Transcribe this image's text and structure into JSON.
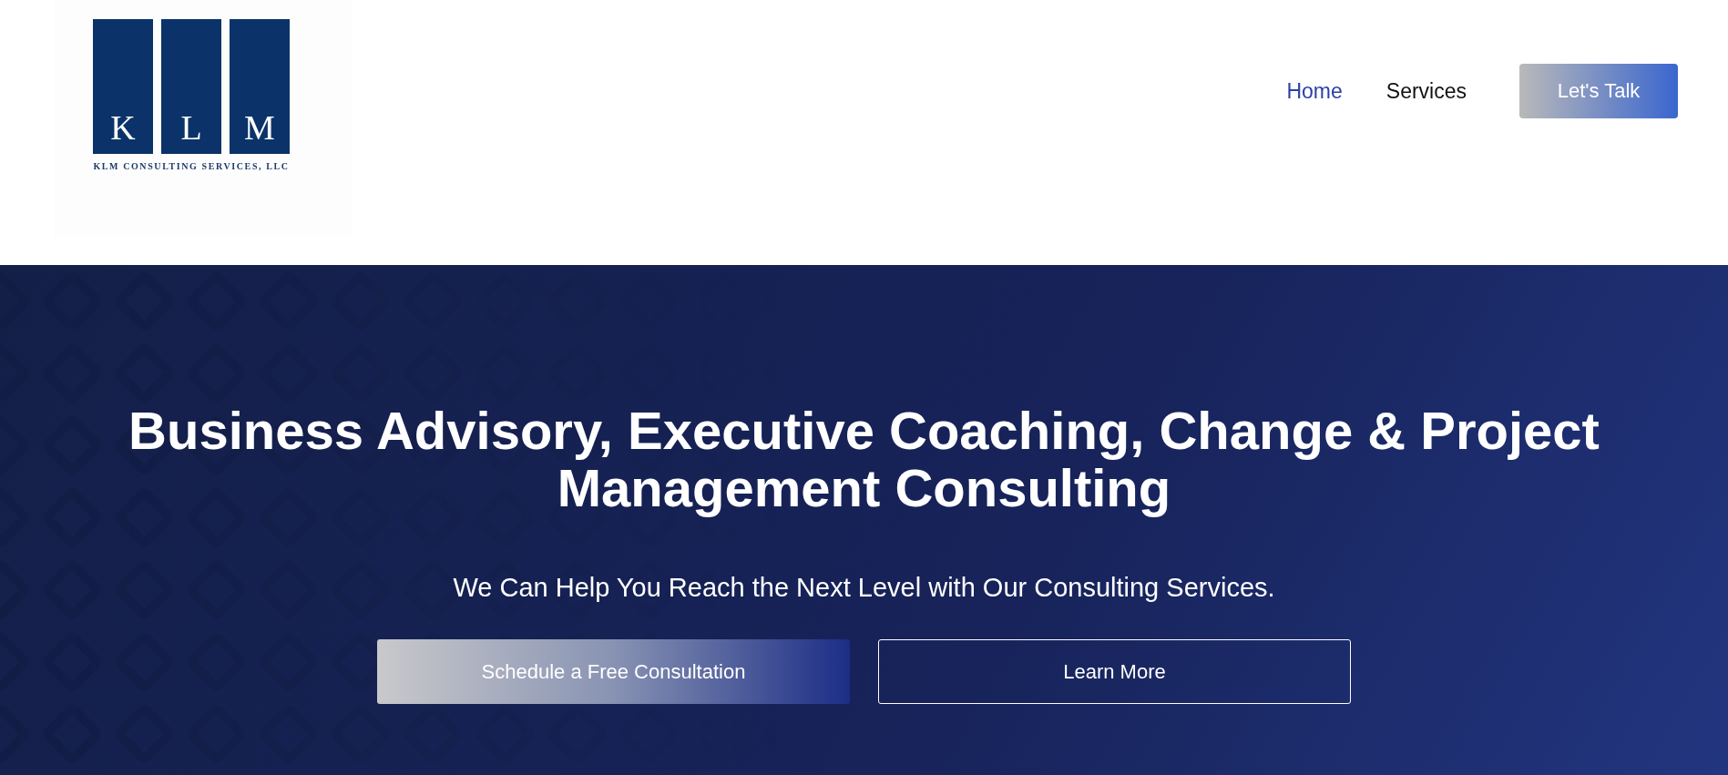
{
  "logo": {
    "letters": [
      "K",
      "L",
      "M"
    ],
    "tagline": "KLM CONSULTING SERVICES, LLC"
  },
  "nav": {
    "items": [
      {
        "label": "Home",
        "selected": true
      },
      {
        "label": "Services",
        "selected": false
      }
    ],
    "cta": "Let's Talk"
  },
  "hero": {
    "heading": "Business Advisory, Executive Coaching, Change & Project Management Consulting",
    "subheading": "We Can Help You Reach the Next Level with Our Consulting Services.",
    "buttons": [
      {
        "label": "Schedule a Free Consultation",
        "kind": "primary"
      },
      {
        "label": "Learn More",
        "kind": "outline"
      }
    ]
  }
}
